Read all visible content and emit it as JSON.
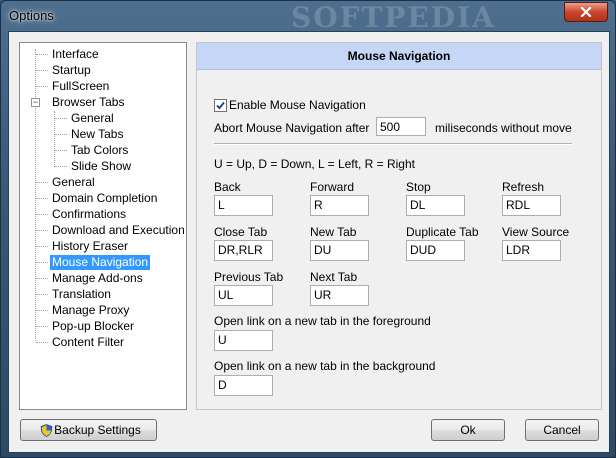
{
  "window": {
    "title": "Options",
    "watermark": "SOFTPEDIA"
  },
  "tree": {
    "items": [
      {
        "label": "Interface"
      },
      {
        "label": "Startup"
      },
      {
        "label": "FullScreen"
      },
      {
        "label": "Browser Tabs",
        "expanded": true
      },
      {
        "label": "General",
        "child": true
      },
      {
        "label": "New Tabs",
        "child": true
      },
      {
        "label": "Tab Colors",
        "child": true
      },
      {
        "label": "Slide Show",
        "child": true
      },
      {
        "label": "General"
      },
      {
        "label": "Domain Completion"
      },
      {
        "label": "Confirmations"
      },
      {
        "label": "Download and Execution"
      },
      {
        "label": "History Eraser"
      },
      {
        "label": "Mouse Navigation",
        "selected": true
      },
      {
        "label": "Manage Add-ons"
      },
      {
        "label": "Translation"
      },
      {
        "label": "Manage Proxy"
      },
      {
        "label": "Pop-up Blocker"
      },
      {
        "label": "Content Filter"
      }
    ]
  },
  "panel": {
    "title": "Mouse Navigation",
    "enable_label": "Enable Mouse Navigation",
    "enable_checked": true,
    "abort_label": "Abort Mouse Navigation after",
    "abort_value": "500",
    "abort_suffix": "miliseconds without move",
    "legend": "U = Up, D = Down, L = Left, R = Right",
    "gestures": [
      {
        "label": "Back",
        "value": "L"
      },
      {
        "label": "Forward",
        "value": "R"
      },
      {
        "label": "Stop",
        "value": "DL"
      },
      {
        "label": "Refresh",
        "value": "RDL"
      },
      {
        "label": "Close Tab",
        "value": "DR,RLR"
      },
      {
        "label": "New Tab",
        "value": "DU"
      },
      {
        "label": "Duplicate Tab",
        "value": "DUD"
      },
      {
        "label": "View Source",
        "value": "LDR"
      },
      {
        "label": "Previous Tab",
        "value": "UL"
      },
      {
        "label": "Next Tab",
        "value": "UR"
      }
    ],
    "fg_label": "Open link on a new tab in the foreground",
    "fg_value": "U",
    "bg_label": "Open link on a new tab in the background",
    "bg_value": "D"
  },
  "buttons": {
    "backup": "Backup Settings",
    "ok": "Ok",
    "cancel": "Cancel"
  },
  "colors": {
    "selection": "#3399ff",
    "header": "#c6d6f6"
  }
}
